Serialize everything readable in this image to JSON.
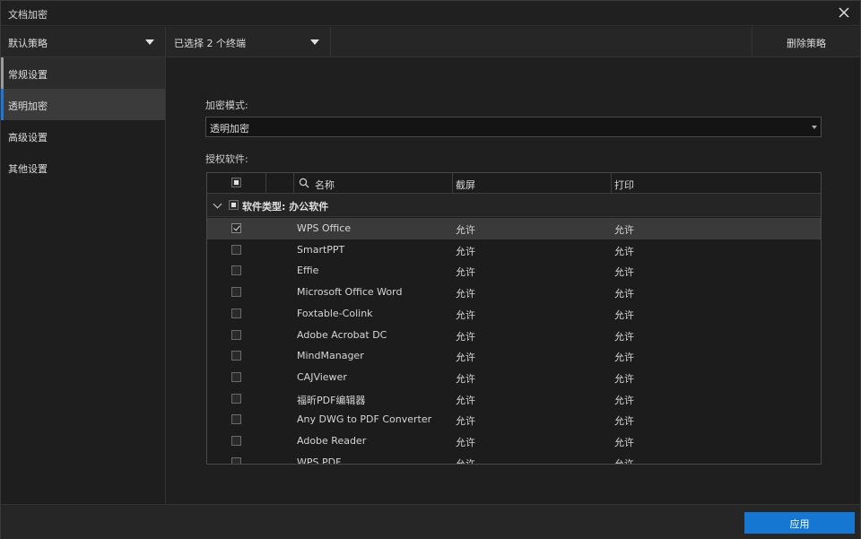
{
  "window": {
    "title": "文档加密",
    "close_icon": "close-icon"
  },
  "toolbar": {
    "policy": "默认策略",
    "terminals": "已选择 2 个终端",
    "delete_label": "删除策略"
  },
  "sidebar": {
    "items": [
      {
        "label": "常规设置"
      },
      {
        "label": "透明加密"
      },
      {
        "label": "高级设置"
      },
      {
        "label": "其他设置"
      }
    ]
  },
  "main": {
    "mode_label": "加密模式:",
    "mode_value": "透明加密",
    "software_label": "授权软件:",
    "table": {
      "headers": {
        "name": "名称",
        "screenshot": "截屏",
        "print": "打印"
      },
      "group": "软件类型: 办公软件",
      "rows": [
        {
          "name": "WPS Office",
          "screenshot": "允许",
          "print": "允许"
        },
        {
          "name": "SmartPPT",
          "screenshot": "允许",
          "print": "允许"
        },
        {
          "name": "Effie",
          "screenshot": "允许",
          "print": "允许"
        },
        {
          "name": "Microsoft Office Word",
          "screenshot": "允许",
          "print": "允许"
        },
        {
          "name": "Foxtable-Colink",
          "screenshot": "允许",
          "print": "允许"
        },
        {
          "name": "Adobe Acrobat DC",
          "screenshot": "允许",
          "print": "允许"
        },
        {
          "name": "MindManager",
          "screenshot": "允许",
          "print": "允许"
        },
        {
          "name": "CAJViewer",
          "screenshot": "允许",
          "print": "允许"
        },
        {
          "name": "福昕PDF编辑器",
          "screenshot": "允许",
          "print": "允许"
        },
        {
          "name": "Any DWG to PDF Converter",
          "screenshot": "允许",
          "print": "允许"
        },
        {
          "name": "Adobe Reader",
          "screenshot": "允许",
          "print": "允许"
        },
        {
          "name": "WPS PDF",
          "screenshot": "允许",
          "print": "允许"
        }
      ]
    }
  },
  "footer": {
    "apply_label": "应用"
  }
}
